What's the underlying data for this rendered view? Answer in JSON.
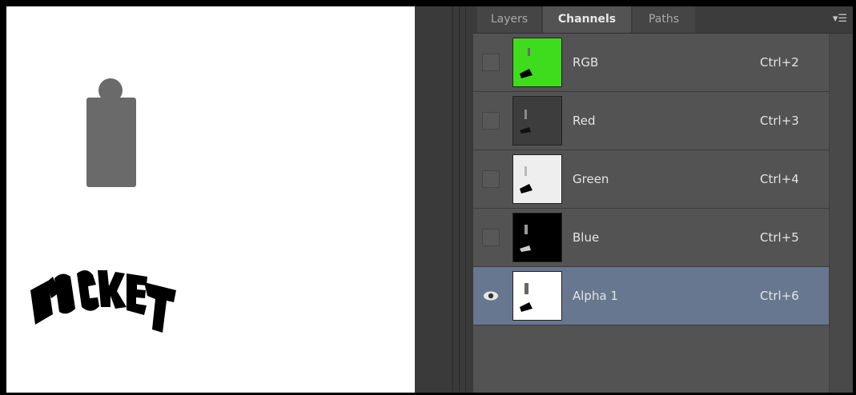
{
  "panel": {
    "tabs": [
      {
        "label": "Layers",
        "active": false
      },
      {
        "label": "Channels",
        "active": true
      },
      {
        "label": "Paths",
        "active": false
      }
    ],
    "menu_icon": "panel-menu-icon"
  },
  "channels": [
    {
      "name": "RGB",
      "shortcut": "Ctrl+2",
      "visible": false,
      "selected": false,
      "thumb_bg": "#3fdc1e"
    },
    {
      "name": "Red",
      "shortcut": "Ctrl+3",
      "visible": false,
      "selected": false,
      "thumb_bg": "#3d3d3d"
    },
    {
      "name": "Green",
      "shortcut": "Ctrl+4",
      "visible": false,
      "selected": false,
      "thumb_bg": "#eeeeee"
    },
    {
      "name": "Blue",
      "shortcut": "Ctrl+5",
      "visible": false,
      "selected": false,
      "thumb_bg": "#000000"
    },
    {
      "name": "Alpha 1",
      "shortcut": "Ctrl+6",
      "visible": true,
      "selected": true,
      "thumb_bg": "#ffffff"
    }
  ],
  "canvas": {
    "artwork_text": "ROCKET",
    "colors": {
      "rocket_shape": "#6a6a6a",
      "text": "#000000",
      "background": "#ffffff"
    }
  },
  "colors": {
    "selected_row": "#677790",
    "panel_bg": "#535353"
  }
}
